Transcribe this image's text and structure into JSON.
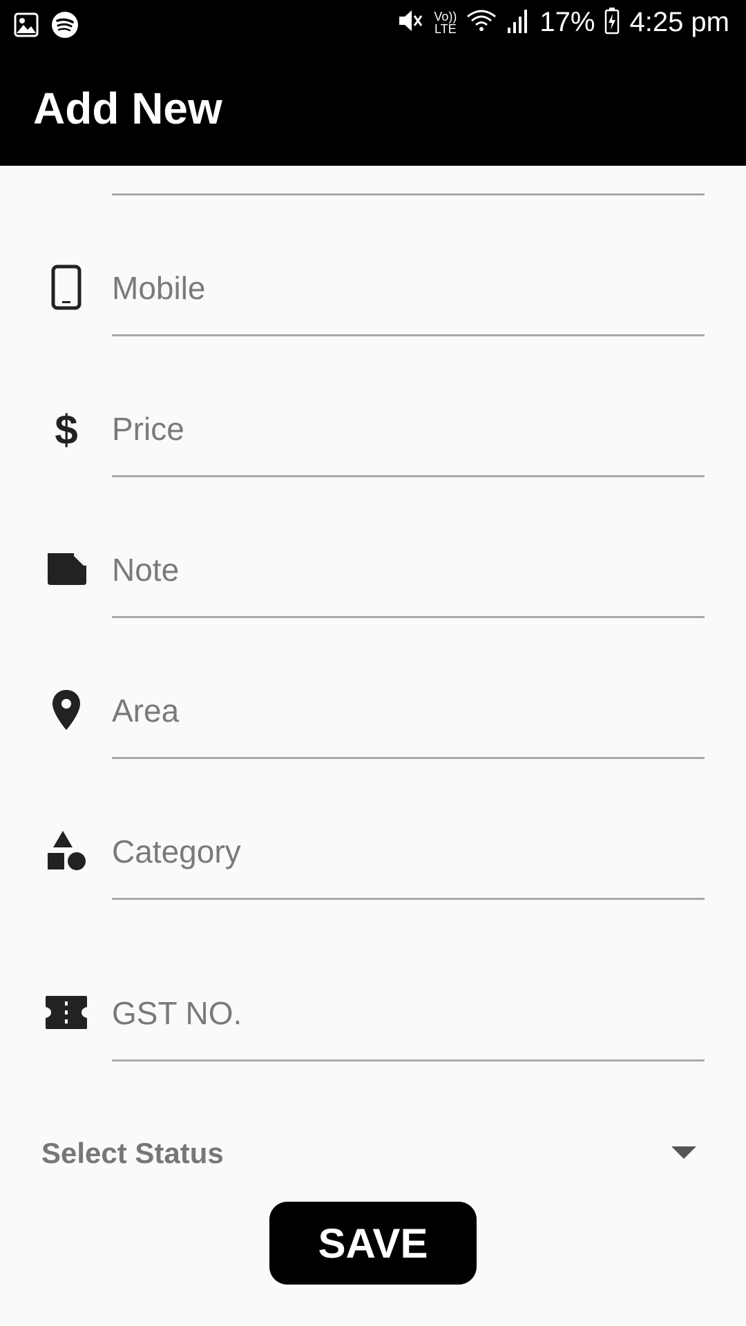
{
  "status_bar": {
    "battery": "17%",
    "time": "4:25 pm",
    "network_top": "Vo))",
    "network_bottom": "LTE",
    "left_icons": [
      "image-icon",
      "spotify-icon"
    ],
    "right_icons": [
      "mute-icon",
      "volte-icon",
      "wifi-icon",
      "signal-icon",
      "battery-charging-icon"
    ]
  },
  "app_bar": {
    "title": "Add New"
  },
  "form": {
    "fields": [
      {
        "placeholder": "Mobile",
        "icon": "phone-icon"
      },
      {
        "placeholder": "Price",
        "icon": "dollar-icon"
      },
      {
        "placeholder": "Note",
        "icon": "note-icon"
      },
      {
        "placeholder": "Area",
        "icon": "location-pin-icon"
      },
      {
        "placeholder": "Category",
        "icon": "category-icon"
      },
      {
        "placeholder": "GST NO.",
        "icon": "ticket-icon"
      }
    ],
    "select_status": {
      "label": "Select Status",
      "icon": "dropdown-arrow-icon"
    },
    "save_label": "SAVE"
  },
  "colors": {
    "bar_background": "#000000",
    "page_background": "#fafafa",
    "placeholder_text": "#7a7a7a",
    "underline": "#a9a9a9",
    "button": "#000000"
  }
}
